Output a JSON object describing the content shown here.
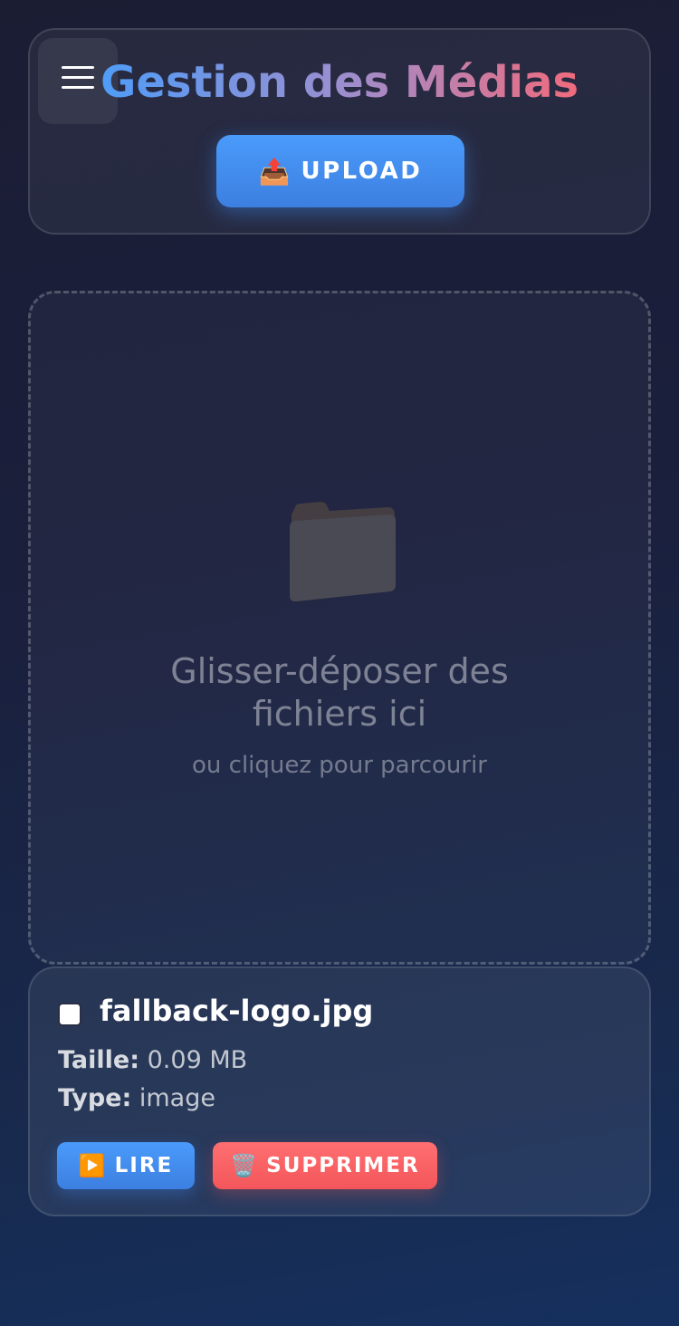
{
  "header": {
    "title": "Gestion des Médias",
    "upload_icon": "📤",
    "upload_label": "UPLOAD"
  },
  "dropzone": {
    "icon": "folder-icon",
    "title": "Glisser-déposer des fichiers ici",
    "subtitle": "ou cliquez pour parcourir"
  },
  "files": [
    {
      "name": "fallback-logo.jpg",
      "size_label": "Taille:",
      "size_value": "0.09 MB",
      "type_label": "Type:",
      "type_value": "image",
      "checked": false,
      "play_icon": "▶️",
      "play_label": "LIRE",
      "delete_icon": "🗑️",
      "delete_label": "SUPPRIMER"
    }
  ],
  "colors": {
    "accent_blue": "#4a9bfb",
    "danger_red": "#ff6f71",
    "title_gradient": [
      "#4f9cf7",
      "#9b8fd0",
      "#f06b7d"
    ]
  }
}
